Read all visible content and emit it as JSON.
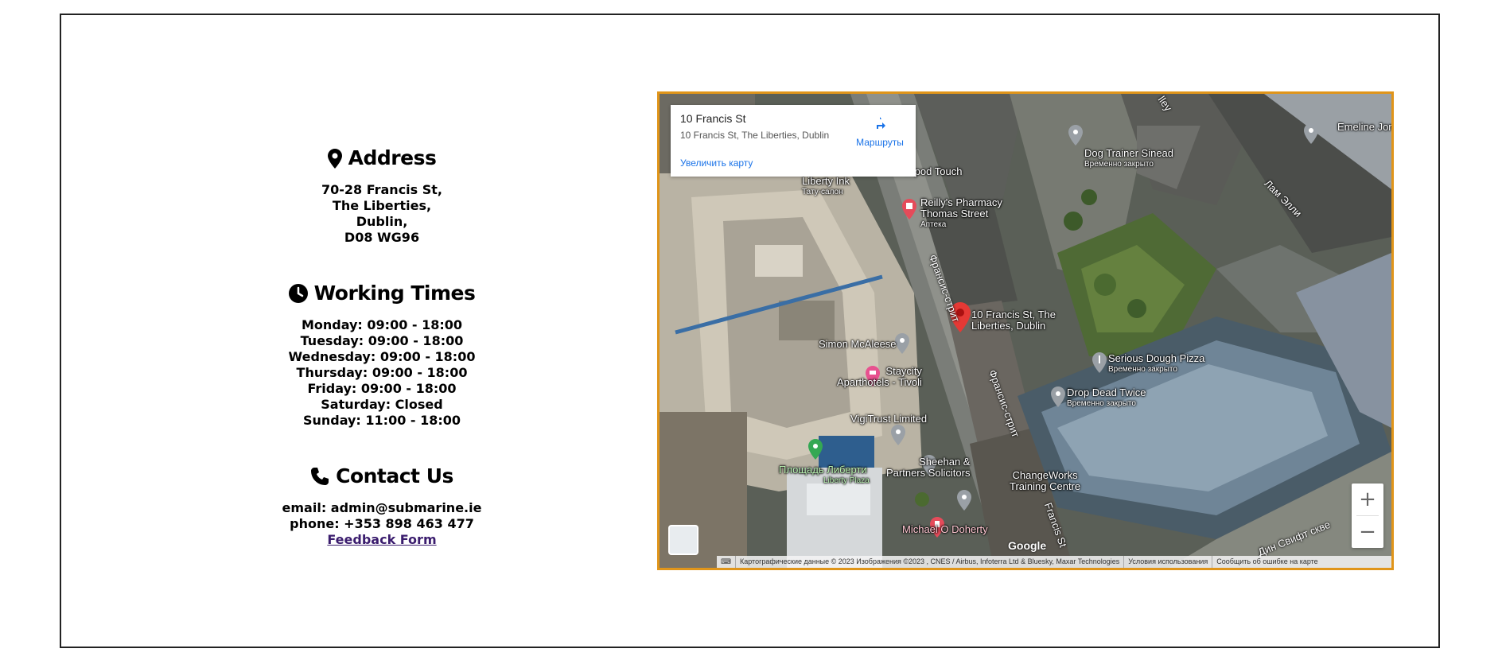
{
  "address": {
    "title": "Address",
    "lines": [
      "70-28 Francis St,",
      "The Liberties,",
      "Dublin,",
      "D08 WG96"
    ]
  },
  "working_times": {
    "title": "Working Times",
    "lines": [
      "Monday: 09:00 - 18:00",
      "Tuesday: 09:00 - 18:00",
      "Wednesday: 09:00 - 18:00",
      "Thursday: 09:00 - 18:00",
      "Friday: 09:00 - 18:00",
      "Saturday: Closed",
      "Sunday: 11:00 - 18:00"
    ]
  },
  "contact": {
    "title": "Contact Us",
    "email": "email: admin@submarine.ie",
    "phone": "phone: +353 898 463 477",
    "feedback_label": "Feedback Form"
  },
  "map": {
    "card": {
      "title": "10 Francis St",
      "subtitle": "10 Francis St, The Liberties, Dublin",
      "routes_label": "Маршруты",
      "enlarge_label": "Увеличить карту"
    },
    "labels": {
      "liberty_ink": "Liberty Ink",
      "liberty_ink_sub": "Тату-салон",
      "tripod": "Tripod Touch",
      "reilly_1": "Reilly's Pharmacy",
      "reilly_2": "Thomas Street",
      "reilly_sub": "Аптека",
      "dog_trainer": "Dog Trainer Sinead",
      "dog_trainer_sub": "Временно закрыто",
      "emeline": "Emeline Jonet",
      "francis_marker_1": "10 Francis St, The",
      "francis_marker_2": "Liberties, Dublin",
      "simon": "Simon McAleese",
      "staycity_1": "Staycity",
      "staycity_2": "Aparthotels - Tivoli",
      "serious_dough": "Serious Dough Pizza",
      "serious_dough_sub": "Временно закрыто",
      "drop_dead": "Drop Dead Twice",
      "drop_dead_sub": "Временно закрыто",
      "vigitrust": "VigiTrust Limited",
      "sheehan_1": "Sheehan &",
      "sheehan_2": "Partners Solicitors",
      "liberty_plaza_1": "Площадь Либерти",
      "liberty_plaza_2": "Liberty Plaza",
      "changeworks_1": "ChangeWorks",
      "changeworks_2": "Training Centre",
      "michael": "Michael O Doherty",
      "street_francis_1": "Франсис-стрит",
      "street_francis_2": "Франсис-стрит",
      "street_francis_3": "Francis St",
      "street_lamb": "Лам Элли",
      "street_dean": "Дин Свифт скве",
      "street_top": "lley"
    },
    "attribution": [
      "Картографические данные © 2023 Изображения ©2023 , CNES / Airbus, Infoterra Ltd & Bluesky, Maxar Technologies",
      "Условия использования",
      "Сообщить об ошибке на карте"
    ],
    "google": "Google",
    "zoom_in": "+",
    "zoom_out": "−"
  }
}
